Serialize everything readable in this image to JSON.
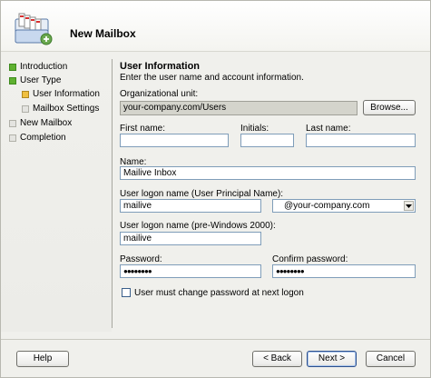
{
  "wizard": {
    "title": "New Mailbox"
  },
  "nav": {
    "items": [
      {
        "label": "Introduction",
        "state": "done"
      },
      {
        "label": "User Type",
        "state": "done"
      },
      {
        "label": "User Information",
        "state": "current"
      },
      {
        "label": "Mailbox Settings",
        "state": "pending"
      },
      {
        "label": "New Mailbox",
        "state": "pending"
      },
      {
        "label": "Completion",
        "state": "pending"
      }
    ]
  },
  "page": {
    "title": "User Information",
    "description": "Enter the user name and account information."
  },
  "form": {
    "org_unit": {
      "label": "Organizational unit:",
      "value": "your-company.com/Users"
    },
    "browse_label": "Browse...",
    "first_name": {
      "label": "First name:",
      "value": ""
    },
    "initials": {
      "label": "Initials:",
      "value": ""
    },
    "last_name": {
      "label": "Last name:",
      "value": ""
    },
    "name": {
      "label": "Name:",
      "value": "Mailive Inbox"
    },
    "upn": {
      "label": "User logon name (User Principal Name):",
      "value": "mailive",
      "domain": "@your-company.com"
    },
    "pre2000": {
      "label": "User logon name (pre-Windows 2000):",
      "value": "mailive"
    },
    "password": {
      "label": "Password:",
      "value": "●●●●●●●●"
    },
    "confirm_password": {
      "label": "Confirm password:",
      "value": "●●●●●●●●"
    },
    "must_change": {
      "label": "User must change password at next logon",
      "checked": false
    }
  },
  "footer": {
    "help": "Help",
    "back": "< Back",
    "next": "Next >",
    "cancel": "Cancel"
  },
  "colors": {
    "done": "#5fb130",
    "current": "#f0c040",
    "pending": "#e4e4e0"
  }
}
